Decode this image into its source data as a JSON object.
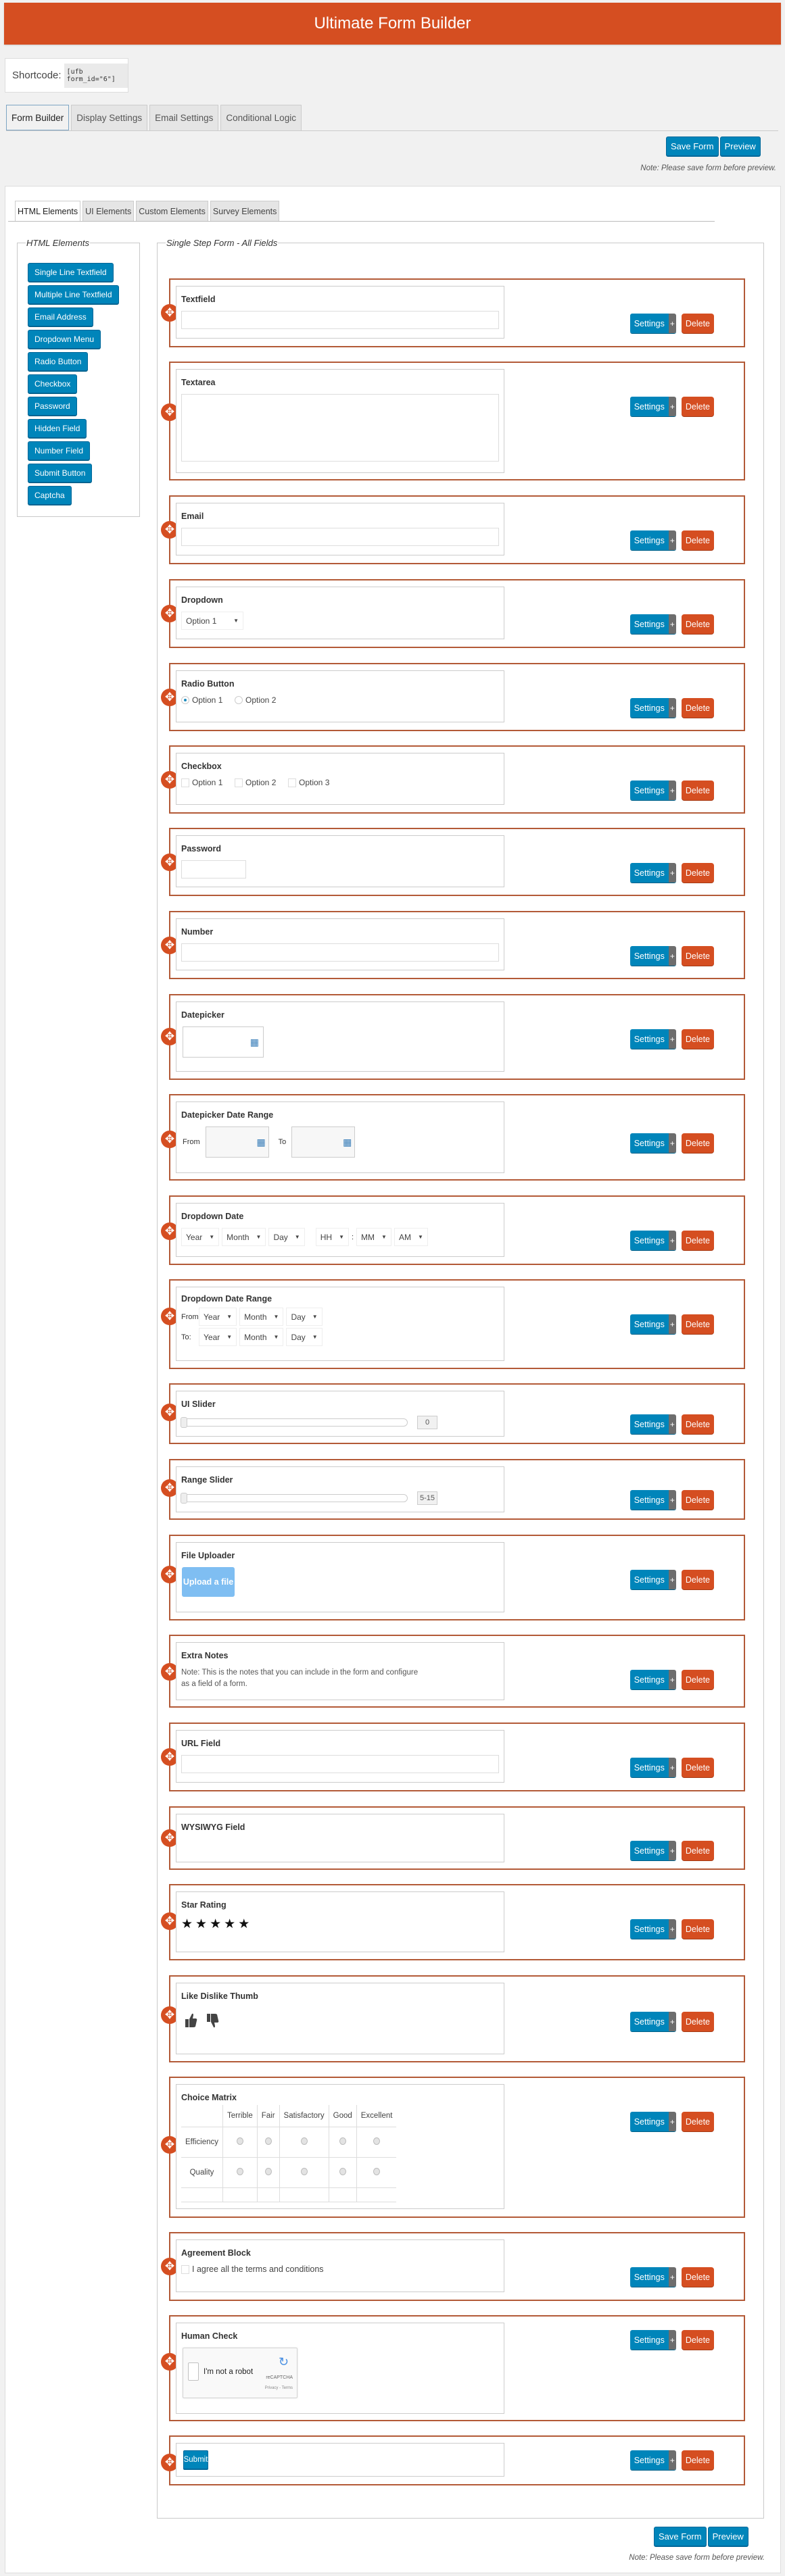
{
  "header": {
    "title": "Ultimate Form Builder"
  },
  "shortcode": {
    "label": "Shortcode:",
    "value": "[ufb form_id=\"6\"]"
  },
  "main_tabs": [
    {
      "label": "Form Builder",
      "active": true
    },
    {
      "label": "Display Settings",
      "active": false
    },
    {
      "label": "Email Settings",
      "active": false
    },
    {
      "label": "Conditional Logic",
      "active": false
    }
  ],
  "actions": {
    "save_label": "Save Form",
    "preview_label": "Preview",
    "note": "Note: Please save form before preview."
  },
  "inner_tabs": [
    {
      "label": "HTML Elements",
      "active": true
    },
    {
      "label": "UI Elements",
      "active": false
    },
    {
      "label": "Custom Elements",
      "active": false
    },
    {
      "label": "Survey Elements",
      "active": false
    }
  ],
  "sidebar": {
    "legend": "HTML Elements",
    "items": [
      "Single Line Textfield",
      "Multiple Line Textfield",
      "Email Address",
      "Dropdown Menu",
      "Radio Button",
      "Checkbox",
      "Password",
      "Hidden Field",
      "Number Field",
      "Submit Button",
      "Captcha"
    ]
  },
  "form": {
    "legend": "Single Step Form - All Fields",
    "settings_label": "Settings",
    "settings_plus": "+",
    "delete_label": "Delete",
    "drag_icon": "move-icon",
    "fields": {
      "textfield": {
        "label": "Textfield"
      },
      "textarea": {
        "label": "Textarea"
      },
      "email": {
        "label": "Email"
      },
      "dropdown": {
        "label": "Dropdown",
        "selected": "Option 1"
      },
      "radio": {
        "label": "Radio Button",
        "options": [
          "Option 1",
          "Option 2"
        ],
        "checked": "Option 1"
      },
      "checkbox": {
        "label": "Checkbox",
        "options": [
          "Option 1",
          "Option 2",
          "Option 3"
        ]
      },
      "password": {
        "label": "Password"
      },
      "number": {
        "label": "Number"
      },
      "datepicker": {
        "label": "Datepicker",
        "icon": "calendar-icon"
      },
      "date_range": {
        "label": "Datepicker Date Range",
        "from": "From",
        "to": "To"
      },
      "dropdown_date": {
        "label": "Dropdown Date",
        "selects": [
          "Year",
          "Month",
          "Day",
          "HH",
          "MM",
          "AM"
        ],
        "time_sep": ":"
      },
      "dropdown_date_range": {
        "label": "Dropdown Date Range",
        "from": "From:",
        "to": "To:",
        "selects": [
          "Year",
          "Month",
          "Day"
        ]
      },
      "ui_slider": {
        "label": "UI Slider",
        "value": "0"
      },
      "range_slider": {
        "label": "Range Slider",
        "value": "5-15"
      },
      "file_uploader": {
        "label": "File Uploader",
        "button": "Upload a file"
      },
      "extra_notes": {
        "label": "Extra Notes",
        "text": "Note: This is the notes that you can include in the form and configure as a field of a form."
      },
      "url": {
        "label": "URL Field"
      },
      "wysiwyg": {
        "label": "WYSIWYG Field"
      },
      "star_rating": {
        "label": "Star Rating",
        "stars": 5,
        "star_glyph": "★"
      },
      "like_dislike": {
        "label": "Like Dislike Thumb"
      },
      "choice_matrix": {
        "label": "Choice Matrix",
        "columns": [
          "Terrible",
          "Fair",
          "Satisfactory",
          "Good",
          "Excellent"
        ],
        "rows": [
          "Efficiency",
          "Quality"
        ]
      },
      "agreement": {
        "label": "Agreement Block",
        "text": "I agree all the terms and conditions"
      },
      "human_check": {
        "label": "Human Check",
        "captcha_text": "I'm not a robot",
        "brand": "reCAPTCHA",
        "links": "Privacy - Terms"
      },
      "submit": {
        "label": "Submit"
      }
    }
  },
  "colors": {
    "brand": "#d54e21",
    "primary": "#0085ba",
    "card_border": "#b35a37"
  }
}
